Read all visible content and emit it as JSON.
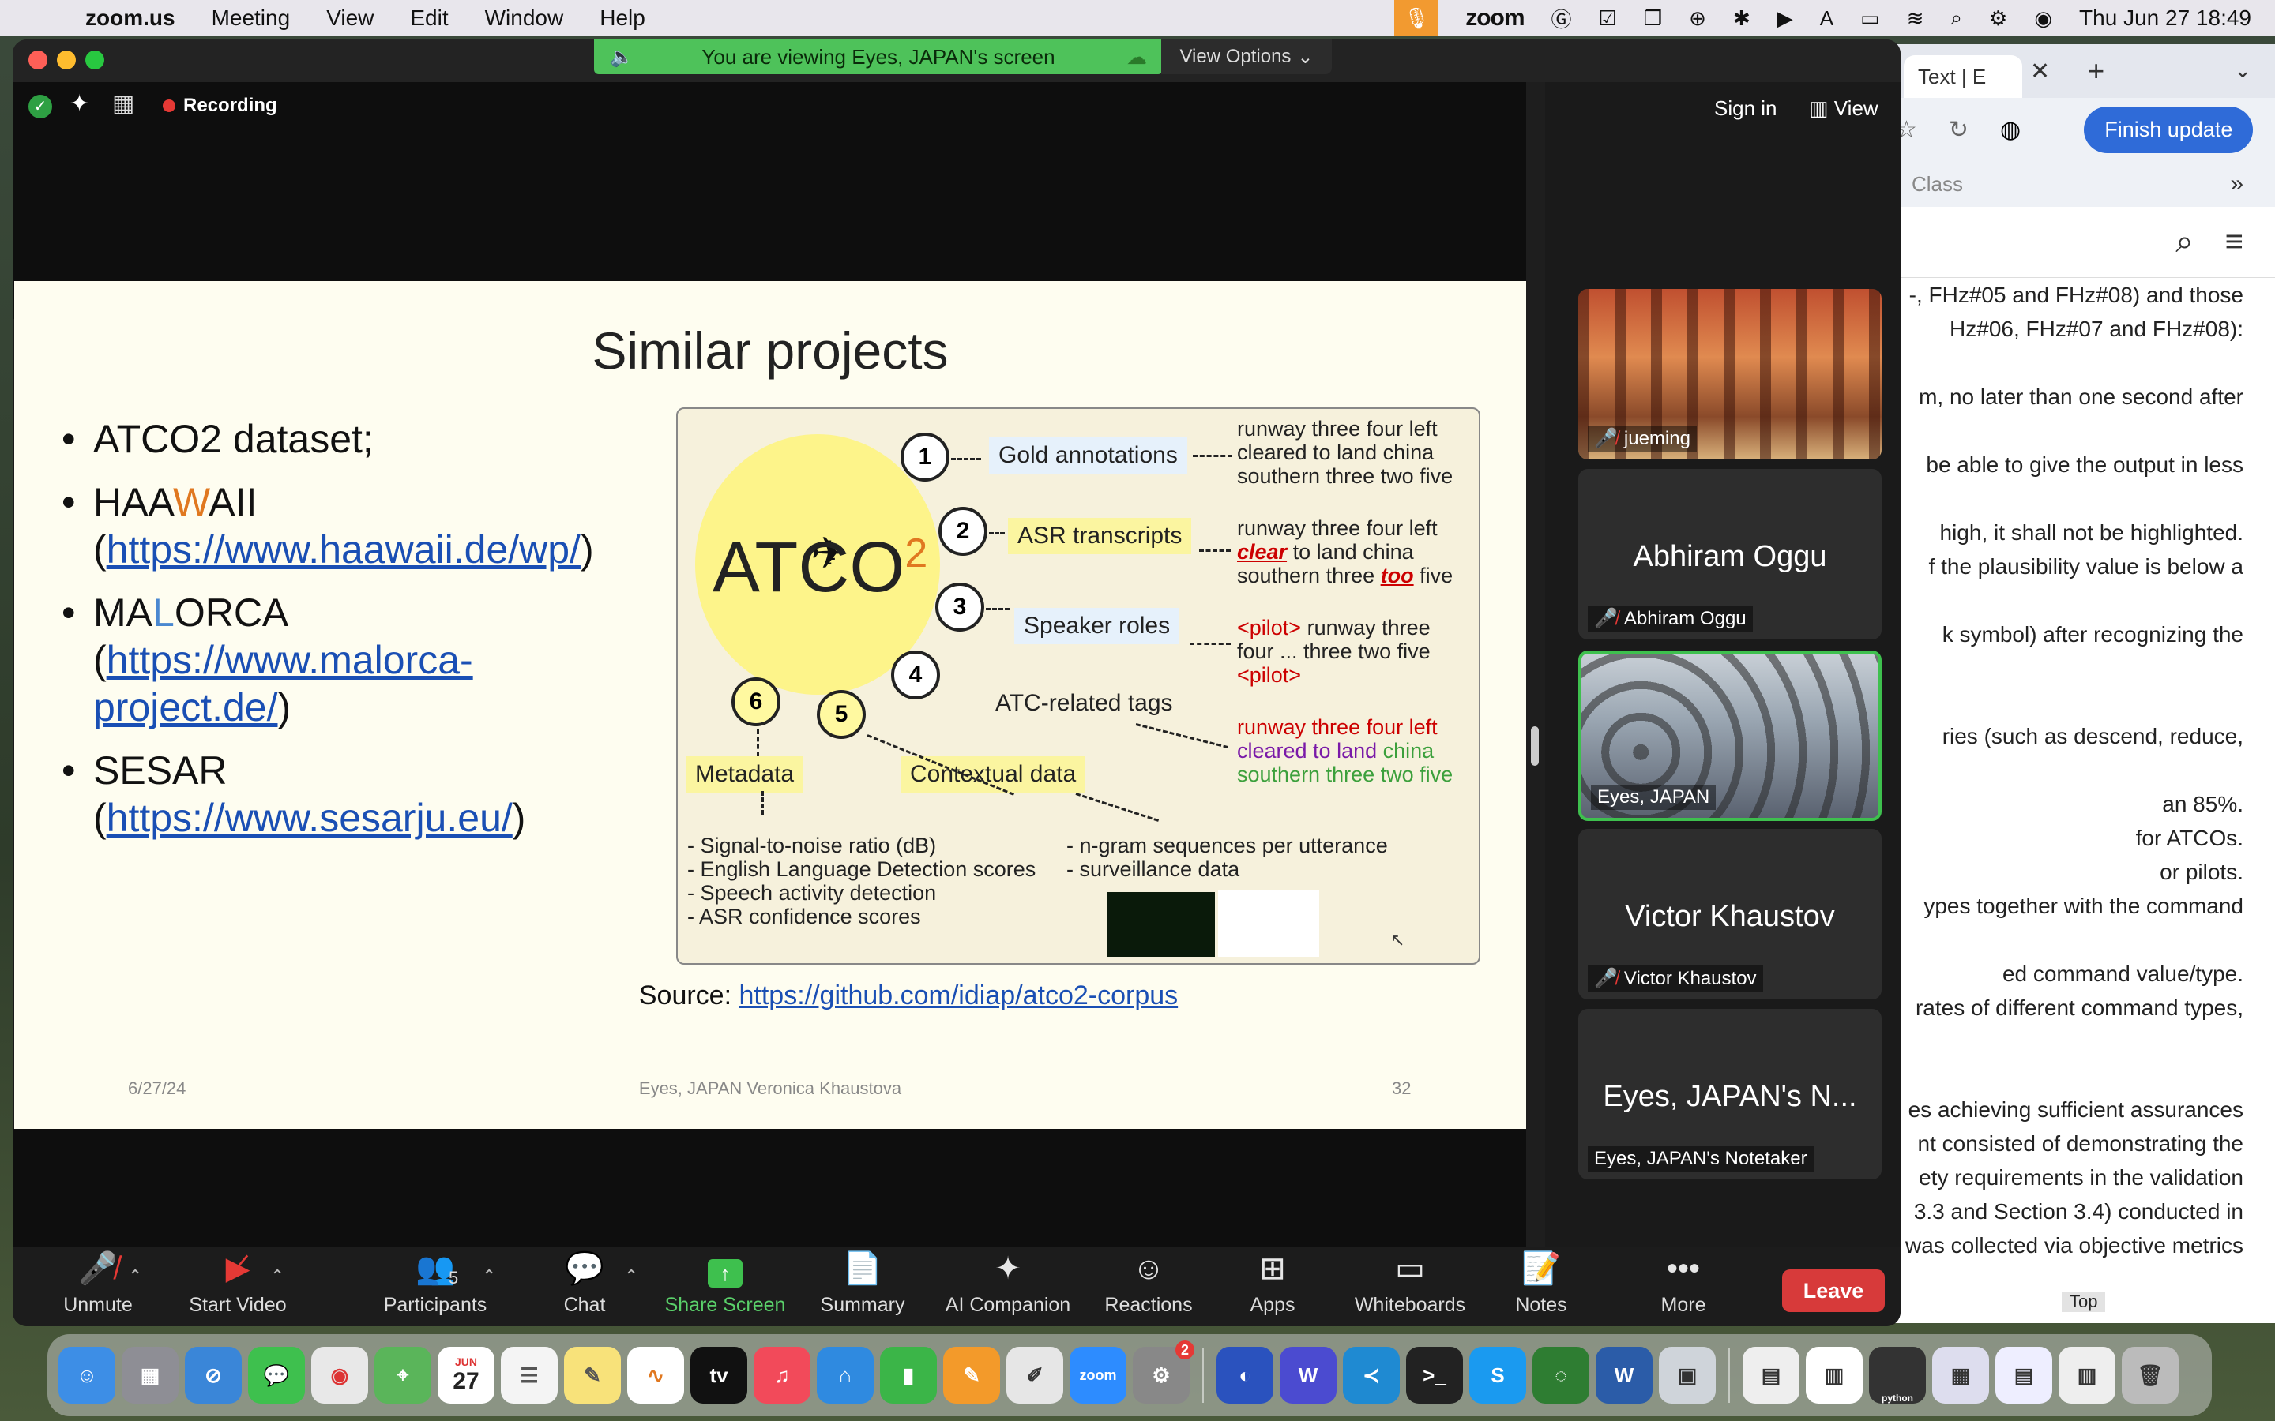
{
  "menubar": {
    "app_name": "zoom.us",
    "items": [
      "Meeting",
      "View",
      "Edit",
      "Window",
      "Help"
    ],
    "zoom_label": "zoom",
    "clock": "Thu Jun 27  18:49"
  },
  "browser": {
    "tab_label": "Text | E",
    "finish_update": "Finish update",
    "bookmark_label": "Class",
    "doc_lines": [
      "-, FHz#05 and FHz#08) and those",
      "Hz#06, FHz#07 and FHz#08):",
      "",
      "m, no later than one second after",
      "",
      "be able to give the output in less",
      "",
      "high, it shall not be highlighted.",
      "f the plausibility value is below a",
      "",
      "k symbol) after recognizing the",
      "",
      "",
      "ries (such as descend, reduce,",
      "",
      "an 85%.",
      "for ATCOs.",
      "or pilots.",
      "ypes together with the command",
      "",
      "ed command value/type.",
      "rates of different command types,",
      "",
      "",
      "es achieving sufficient assurances",
      "nt consisted of demonstrating the",
      "ety requirements in the validation",
      "3.3 and Section 3.4) conducted in",
      "was collected via objective metrics"
    ],
    "top_overlay": "Top"
  },
  "zoom": {
    "banner": "You are viewing Eyes, JAPAN's screen",
    "view_options": "View Options",
    "recording": "Recording",
    "sign_in": "Sign in",
    "view": "View",
    "participants_count": "5"
  },
  "slide": {
    "title": "Similar projects",
    "bullets": [
      {
        "name": "ATCO2 dataset;"
      },
      {
        "name_parts": [
          "HAA",
          "W",
          "AII"
        ],
        "link": "https://www.haawaii.de/wp/"
      },
      {
        "name_parts": [
          "MA",
          "L",
          "ORCA"
        ],
        "link_line1": "https://www.malorca-",
        "link_line2": "project.de/"
      },
      {
        "name": "SESAR",
        "link": "https://www.sesarju.eu/"
      }
    ],
    "figure": {
      "logo_text": "ATCO",
      "logo_sup": "2",
      "numbers": [
        "1",
        "2",
        "3",
        "4",
        "5",
        "6"
      ],
      "labels": {
        "gold": "Gold annotations",
        "asr": "ASR transcripts",
        "speaker": "Speaker roles",
        "atc_tags": "ATC-related tags",
        "metadata": "Metadata",
        "contextual": "Contextual data"
      },
      "gold_text": [
        "runway three four left",
        "cleared to land china",
        "southern three two five"
      ],
      "asr_text": {
        "l1": "runway three four left",
        "l2_em": "clear",
        "l2_rest": " to land china",
        "l3_pre": "southern three ",
        "l3_em": "too",
        "l3_post": " five"
      },
      "speaker_text": {
        "l1_tag": "<pilot>",
        "l1_rest": " runway three",
        "l2": "four ... three two five",
        "l3_tag": "<pilot>"
      },
      "atc_text": {
        "l1": "runway three four left",
        "l2a": "cleared to land",
        "l2b": " china",
        "l3": "southern three two five"
      },
      "metadata_list": [
        "- Signal-to-noise ratio (dB)",
        "- English Language Detection scores",
        "- Speech activity detection",
        "- ASR confidence scores"
      ],
      "contextual_list": [
        "- n-gram sequences per utterance",
        "- surveillance data"
      ]
    },
    "source_label": "Source:",
    "source_link": "https://github.com/idiap/atco2-corpus",
    "footer_date": "6/27/24",
    "footer_mid": "Eyes, JAPAN Veronica Khaustova",
    "footer_page": "32"
  },
  "participants": [
    {
      "tag": "jueming"
    },
    {
      "big": "Abhiram Oggu",
      "tag": "Abhiram Oggu"
    },
    {
      "tag": "Eyes, JAPAN"
    },
    {
      "big": "Victor Khaustov",
      "tag": "Victor Khaustov"
    },
    {
      "big": "Eyes, JAPAN's N...",
      "tag": "Eyes, JAPAN's Notetaker"
    }
  ],
  "toolbar": {
    "unmute": "Unmute",
    "start_video": "Start Video",
    "participants": "Participants",
    "chat": "Chat",
    "share_screen": "Share Screen",
    "summary": "Summary",
    "ai_companion": "AI Companion",
    "reactions": "Reactions",
    "apps": "Apps",
    "whiteboards": "Whiteboards",
    "notes": "Notes",
    "more": "More",
    "leave": "Leave"
  },
  "dock": {
    "calendar_month": "JUN",
    "calendar_day": "27",
    "tv_label": "tv",
    "zoom_label": "zoom",
    "settings_badge": "2",
    "python_label": "python"
  }
}
